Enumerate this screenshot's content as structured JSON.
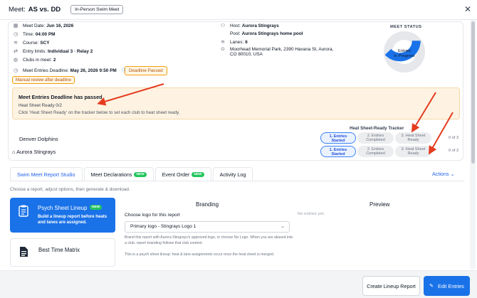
{
  "header": {
    "meet_label": "Meet:",
    "meet_name": "AS vs. DD",
    "meet_type": "In-Person Swim Meet",
    "close_icon": "close-icon"
  },
  "details": {
    "meet_date_label": "Meet Date:",
    "meet_date": "Jun 16, 2026",
    "time_label": "Time:",
    "time": "04:00 PM",
    "course_label": "Course:",
    "course": "SCY",
    "entry_limits_label": "Entry limits:",
    "entry_limits": "Individual 3 · Relay 2",
    "clubs_label": "Clubs in meet:",
    "clubs": "2",
    "deadline_label": "Meet Entries Deadline:",
    "deadline": "May 26, 2026 9:50 PM",
    "deadline_badge": "Deadline Passed",
    "manual_badge": "Manual review after deadline",
    "host_label": "Host:",
    "host": "Aurora Stingrays",
    "pool_label": "Pool:",
    "pool": "Aurora Stingrays home pool",
    "lanes_label": "Lanes:",
    "lanes": "6",
    "address_line1": "Moorhead Memorial Park, 2390 Havana St, Aurora,",
    "address_line2": "CO 80010, USA"
  },
  "status": {
    "title": "MEET STATUS",
    "label_line1": "Entries",
    "label_line2": "In Progress",
    "progress_fraction": 0.38,
    "accent": "#1a72e8",
    "track": "#e5e7eb"
  },
  "alert": {
    "title": "Meet Entries Deadline has passed",
    "subtitle": "Heat Sheet Ready 0/2",
    "description": "Click 'Heat Sheet Ready' on the tracker below to set each club to heat sheet ready."
  },
  "tracker": {
    "title": "Heat Sheet-Ready Tracker",
    "steps": [
      [
        "1. Entries",
        "Started"
      ],
      [
        "2. Entries",
        "Completed"
      ],
      [
        "3. Heat Sheet",
        "Ready"
      ]
    ],
    "clubs": [
      {
        "name": "Denver Dolphins",
        "active_step": 1,
        "count": "0 of 3"
      },
      {
        "name": "Aurora Stingrays",
        "active_step": 1,
        "count": "0 of 3"
      }
    ]
  },
  "tabs": [
    {
      "label": "Swim Meet Report Studio",
      "new": "",
      "active": true
    },
    {
      "label": "Meet Declarations",
      "new": "NEW",
      "active": false
    },
    {
      "label": "Event Order",
      "new": "NEW",
      "active": false
    },
    {
      "label": "Activity Log",
      "new": "",
      "active": false
    }
  ],
  "actions_label": "Actions",
  "report_studio": {
    "choose_text": "Choose a report, adjust options, then generate & download.",
    "psych_card": {
      "title": "Psych Sheet Lineup",
      "new": "NEW",
      "description": "Build a lineup report before heats and lanes are assigned."
    },
    "best_card": {
      "title": "Best Time Matrix"
    },
    "branding": {
      "title": "Branding",
      "logo_label": "Choose logo for this report",
      "logo_value": "Primary logo - Stingrays Logo 1",
      "note": "Brand this report with Aurora Stingrays's approved logo, or choose No Logo. When you are aliased into a club, report branding follows that club context.",
      "psych_note": "This is a psych sheet lineup: heat & lane assignments occur once the heat sheet is merged."
    },
    "preview": {
      "title": "Preview",
      "empty": "No entries yet."
    }
  },
  "footer": {
    "create_label": "Create Lineup Report",
    "edit_label": "Edit Entries"
  },
  "annotation_color": "#e53b1f"
}
